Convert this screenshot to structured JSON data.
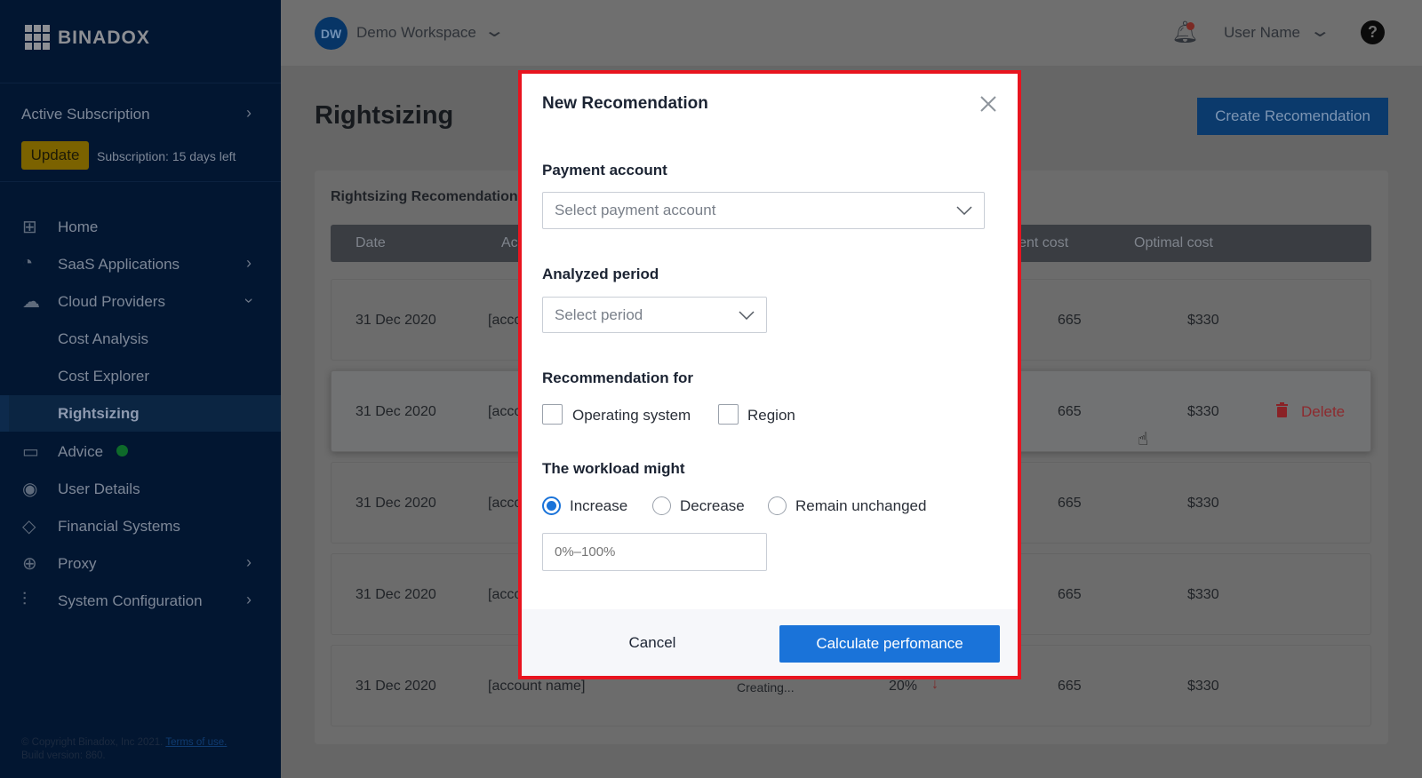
{
  "sidebar": {
    "logo": "BINADOX",
    "subscription_label": "Active Subscription",
    "update_button": "Update",
    "subscription_status": "Subscription: 15 days left",
    "items": [
      {
        "label": "Home",
        "icon": "grid-icon"
      },
      {
        "label": "SaaS Applications",
        "icon": "pie-chart-icon"
      },
      {
        "label": "Cloud Providers",
        "icon": "cloud-icon"
      },
      {
        "label": "Cost Analysis"
      },
      {
        "label": "Cost Explorer"
      },
      {
        "label": "Rightsizing",
        "active": true
      },
      {
        "label": "Advice",
        "icon": "chat-icon",
        "status_color": "#1d9a3f"
      },
      {
        "label": "User Details",
        "icon": "user-circle-icon"
      },
      {
        "label": "Financial Systems",
        "icon": "tag-icon"
      },
      {
        "label": "Proxy",
        "icon": "globe-icon"
      },
      {
        "label": "System Configuration",
        "icon": "sliders-icon"
      }
    ],
    "copyright": "© Copyright Binadox, Inc 2021.",
    "terms_link": "Terms of use.",
    "build": "Build version: 860."
  },
  "header": {
    "workspace_initials": "DW",
    "workspace_name": "Demo Workspace",
    "user_name": "User Name"
  },
  "page": {
    "title": "Rightsizing",
    "create_button": "Create Recomendation",
    "panel_title": "Rightsizing Recomendations",
    "columns": [
      "Date",
      "Account",
      "Current cost",
      "Optimal cost"
    ],
    "rows": [
      {
        "date": "31 Dec 2020",
        "account": "[account name]",
        "current": "665",
        "optimal": "$330"
      },
      {
        "date": "31 Dec 2020",
        "account": "[account name]",
        "current": "665",
        "optimal": "$330",
        "action": "Delete"
      },
      {
        "date": "31 Dec 2020",
        "account": "[account name]",
        "current": "665",
        "optimal": "$330"
      },
      {
        "date": "31 Dec 2020",
        "account": "[account name]",
        "current": "665",
        "optimal": "$330"
      },
      {
        "date": "31 Dec 2020",
        "account": "[account name]",
        "status": "Creating...",
        "percent": "20%",
        "current": "665",
        "optimal": "$330"
      }
    ]
  },
  "modal": {
    "title": "New Recomendation",
    "payment_label": "Payment account",
    "payment_placeholder": "Select payment account",
    "period_label": "Analyzed period",
    "period_placeholder": "Select period",
    "rec_for_label": "Recommendation for",
    "checkboxes": [
      {
        "label": "Operating system",
        "checked": false
      },
      {
        "label": "Region",
        "checked": false
      }
    ],
    "workload_label": "The workload might",
    "radios": [
      {
        "label": "Increase",
        "selected": true
      },
      {
        "label": "Decrease",
        "selected": false
      },
      {
        "label": "Remain unchanged",
        "selected": false
      }
    ],
    "percent_placeholder": "0%–100%",
    "cancel": "Cancel",
    "submit": "Calculate perfomance"
  },
  "colors": {
    "accent": "#1a73d9",
    "highlight_border": "#e8141f",
    "danger": "#a3262b"
  }
}
